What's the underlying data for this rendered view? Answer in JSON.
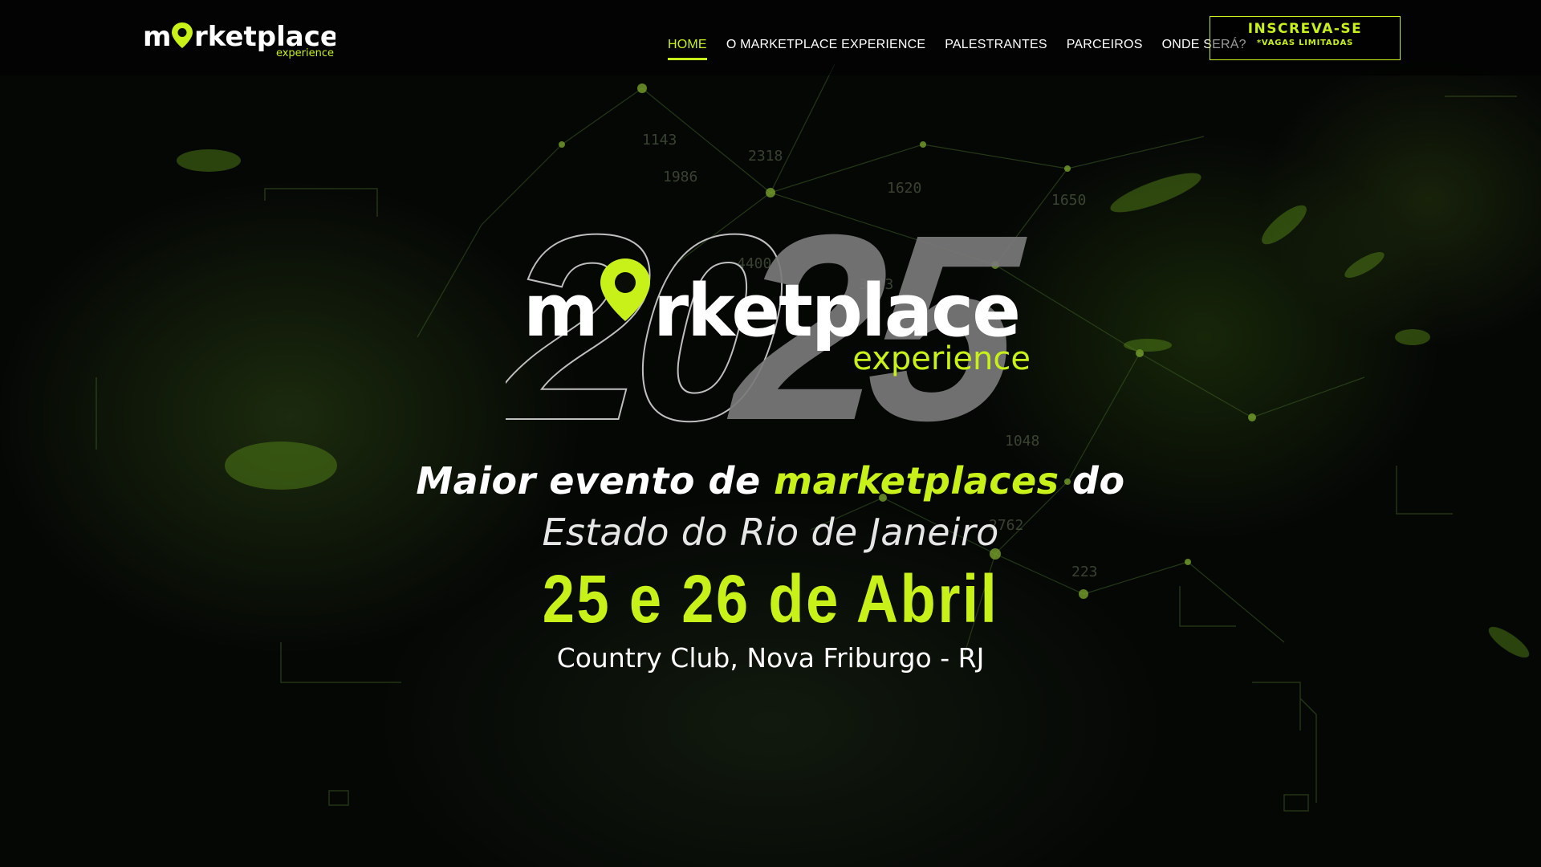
{
  "colors": {
    "accent": "#c8f019",
    "text": "#ffffff",
    "background": "#050705"
  },
  "header": {
    "logo": {
      "pre": "m",
      "post": "rketplace",
      "sub": "experience",
      "pin_icon": "map-pin-icon"
    },
    "nav": [
      {
        "label": "HOME",
        "active": true
      },
      {
        "label": "O MARKETPLACE EXPERIENCE",
        "active": false
      },
      {
        "label": "PALESTRANTES",
        "active": false
      },
      {
        "label": "PARCEIROS",
        "active": false
      },
      {
        "label": "ONDE SERÁ?",
        "active": false
      }
    ],
    "cta": {
      "label": "INSCREVA-SE",
      "sublabel": "*VAGAS LIMITADAS"
    }
  },
  "hero": {
    "logo": {
      "year_left": "20",
      "year_right": "25",
      "pre": "m",
      "post": "rketplace",
      "sub": "experience",
      "pin_icon": "map-pin-icon"
    },
    "tagline": {
      "part1": "Maior evento de ",
      "highlight": "marketplaces",
      "part2": " do"
    },
    "subtagline": "Estado do Rio de Janeiro",
    "dates": "25 e 26 de Abril",
    "venue": "Country Club, Nova Friburgo - RJ"
  },
  "background": {
    "numbers": [
      "1143",
      "2318",
      "1986",
      "1620",
      "1650",
      "4400",
      "3823",
      "2762",
      "223",
      "1048"
    ]
  }
}
